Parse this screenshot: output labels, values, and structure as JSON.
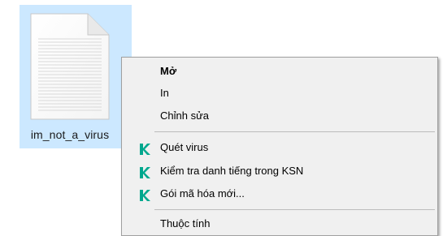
{
  "file": {
    "name": "im_not_a_virus",
    "icon": "text-document-icon"
  },
  "context_menu": {
    "items": [
      {
        "label": "Mở",
        "bold": true
      },
      {
        "label": "In"
      },
      {
        "label": "Chỉnh sửa"
      },
      {
        "label": "Quét virus",
        "icon": "kaspersky-k-icon"
      },
      {
        "label": "Kiểm tra danh tiếng trong KSN",
        "icon": "kaspersky-k-icon"
      },
      {
        "label": "Gói mã hóa mới...",
        "icon": "kaspersky-k-icon"
      },
      {
        "label": "Thuộc tính"
      }
    ]
  },
  "colors": {
    "selection": "#cce8ff",
    "menu_background": "#f0f0f0",
    "kaspersky_green": "#00a88e"
  }
}
